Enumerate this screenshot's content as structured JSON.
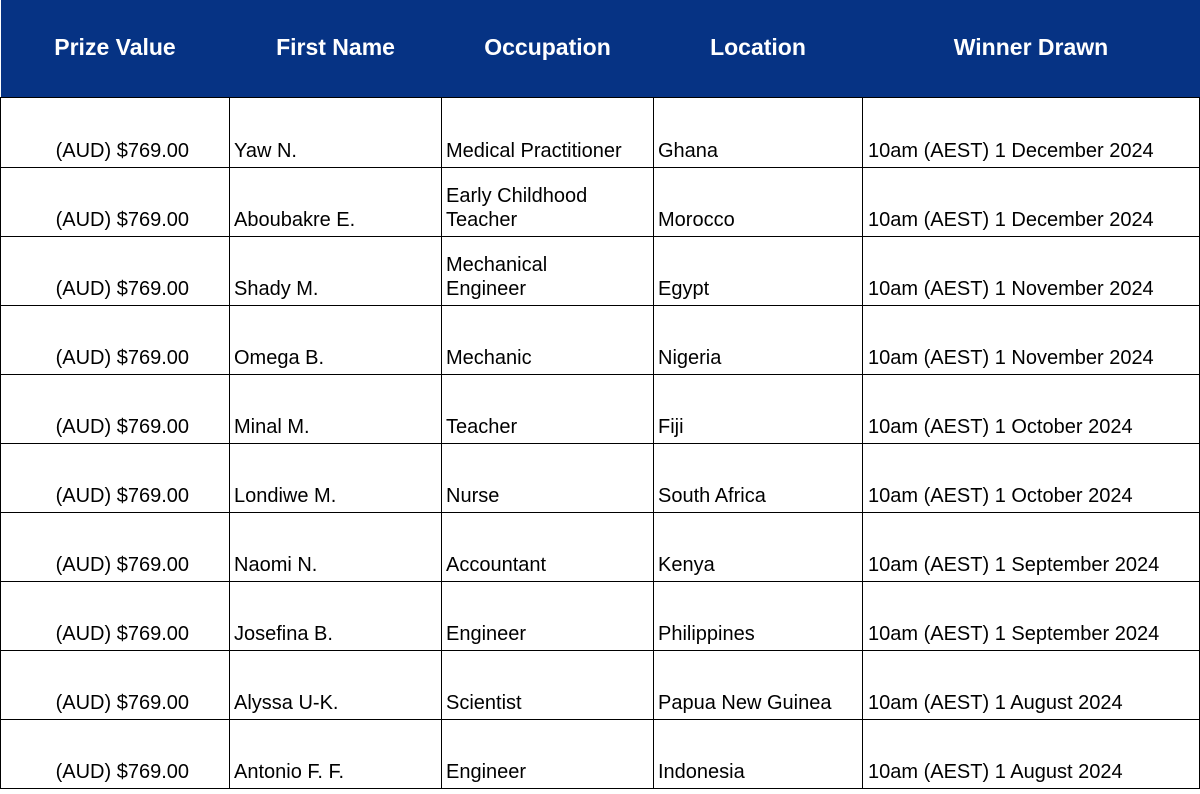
{
  "table": {
    "headers": {
      "prize_value": "Prize Value",
      "first_name": "First Name",
      "occupation": "Occupation",
      "location": "Location",
      "winner_drawn": "Winner Drawn"
    },
    "rows": [
      {
        "prize": "(AUD) $769.00",
        "name": "Yaw N.",
        "occupation": [
          "Medical Practitioner"
        ],
        "location": "Ghana",
        "drawn": "10am (AEST) 1 December 2024"
      },
      {
        "prize": "(AUD) $769.00",
        "name": "Aboubakre E.",
        "occupation": [
          "Early Childhood",
          "Teacher"
        ],
        "location": "Morocco",
        "drawn": "10am (AEST) 1 December 2024"
      },
      {
        "prize": "(AUD) $769.00",
        "name": "Shady M.",
        "occupation": [
          "Mechanical",
          "Engineer"
        ],
        "location": "Egypt",
        "drawn": "10am (AEST) 1 November 2024"
      },
      {
        "prize": "(AUD) $769.00",
        "name": "Omega B.",
        "occupation": [
          "Mechanic"
        ],
        "location": "Nigeria",
        "drawn": "10am (AEST) 1 November 2024"
      },
      {
        "prize": "(AUD) $769.00",
        "name": "Minal M.",
        "occupation": [
          "Teacher"
        ],
        "location": "Fiji",
        "drawn": "10am (AEST) 1 October 2024"
      },
      {
        "prize": "(AUD) $769.00",
        "name": "Londiwe M.",
        "occupation": [
          "Nurse"
        ],
        "location": "South Africa",
        "drawn": "10am (AEST) 1 October 2024"
      },
      {
        "prize": "(AUD) $769.00",
        "name": "Naomi N.",
        "occupation": [
          "Accountant"
        ],
        "location": "Kenya",
        "drawn": "10am (AEST) 1 September 2024"
      },
      {
        "prize": "(AUD) $769.00",
        "name": "Josefina B.",
        "occupation": [
          "Engineer"
        ],
        "location": "Philippines",
        "drawn": "10am (AEST) 1 September 2024"
      },
      {
        "prize": "(AUD) $769.00",
        "name": "Alyssa U-K.",
        "occupation": [
          "Scientist"
        ],
        "location": "Papua New Guinea",
        "drawn": "10am (AEST) 1 August 2024"
      },
      {
        "prize": "(AUD) $769.00",
        "name": "Antonio F. F.",
        "occupation": [
          "Engineer"
        ],
        "location": "Indonesia",
        "drawn": "10am (AEST) 1 August 2024"
      }
    ]
  },
  "colors": {
    "header_bg": "#063384",
    "header_text": "#ffffff",
    "grid_line": "#000000"
  }
}
